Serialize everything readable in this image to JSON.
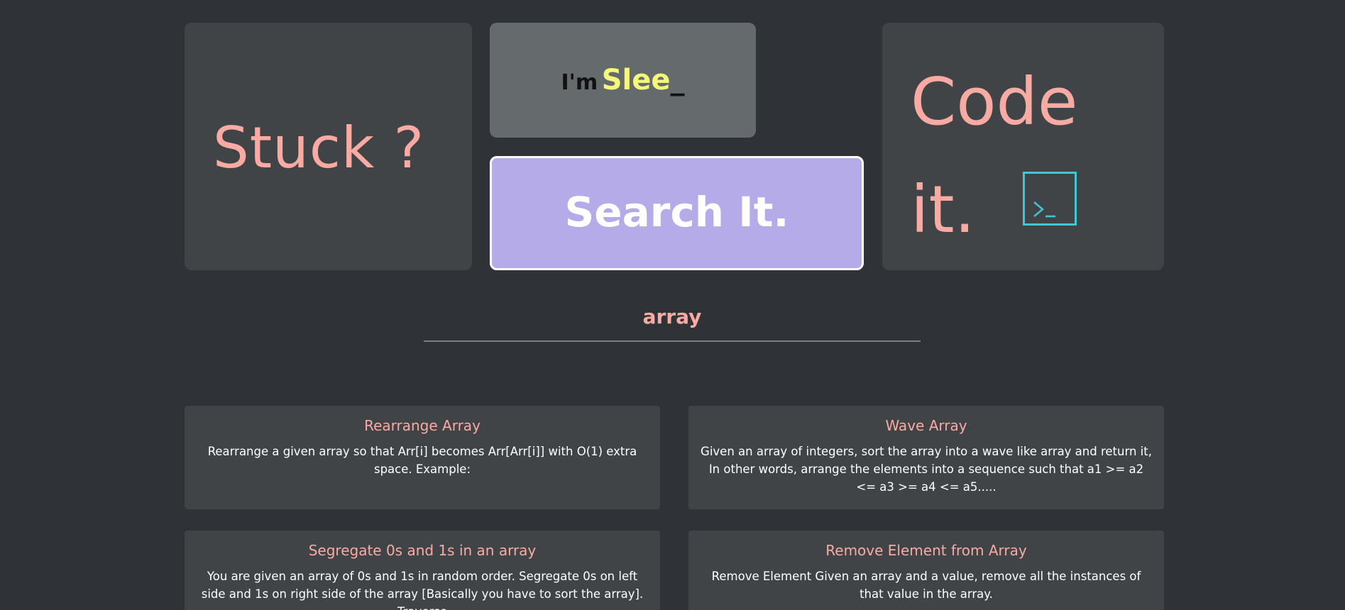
{
  "hero": {
    "stuck_label": "Stuck ?",
    "typewriter": {
      "prefix": "I'm",
      "word": "Slee",
      "cursor": "_"
    },
    "search_label": "Search It.",
    "code_line1": "Code",
    "code_line2": "it.",
    "terminal_icon": "terminal-icon"
  },
  "topic": {
    "label": "array"
  },
  "problems": [
    {
      "title": "Rearrange Array",
      "desc": "Rearrange a given array so that Arr[i] becomes Arr[Arr[i]] with O(1) extra space. Example:"
    },
    {
      "title": "Wave Array",
      "desc": "Given an array of integers, sort the array into a wave like array and return it, In other words, arrange the elements into a sequence such that a1 >= a2 <= a3 >= a4 <= a5....."
    },
    {
      "title": "Segregate 0s and 1s in an array",
      "desc": "You are given an array of 0s and 1s in random order. Segregate 0s on left side and 1s on right side of the array [Basically you have to sort the array]. Traverse"
    },
    {
      "title": "Remove Element from Array",
      "desc": "Remove Element Given an array and a value, remove all the instances of that value in the array."
    }
  ],
  "colors": {
    "background": "#2f3337",
    "card": "#414447",
    "accent_pink": "#f8aaa3",
    "accent_yellow": "#f5f77a",
    "search_purple": "#b4abe8",
    "terminal_cyan": "#3ec8d6"
  }
}
